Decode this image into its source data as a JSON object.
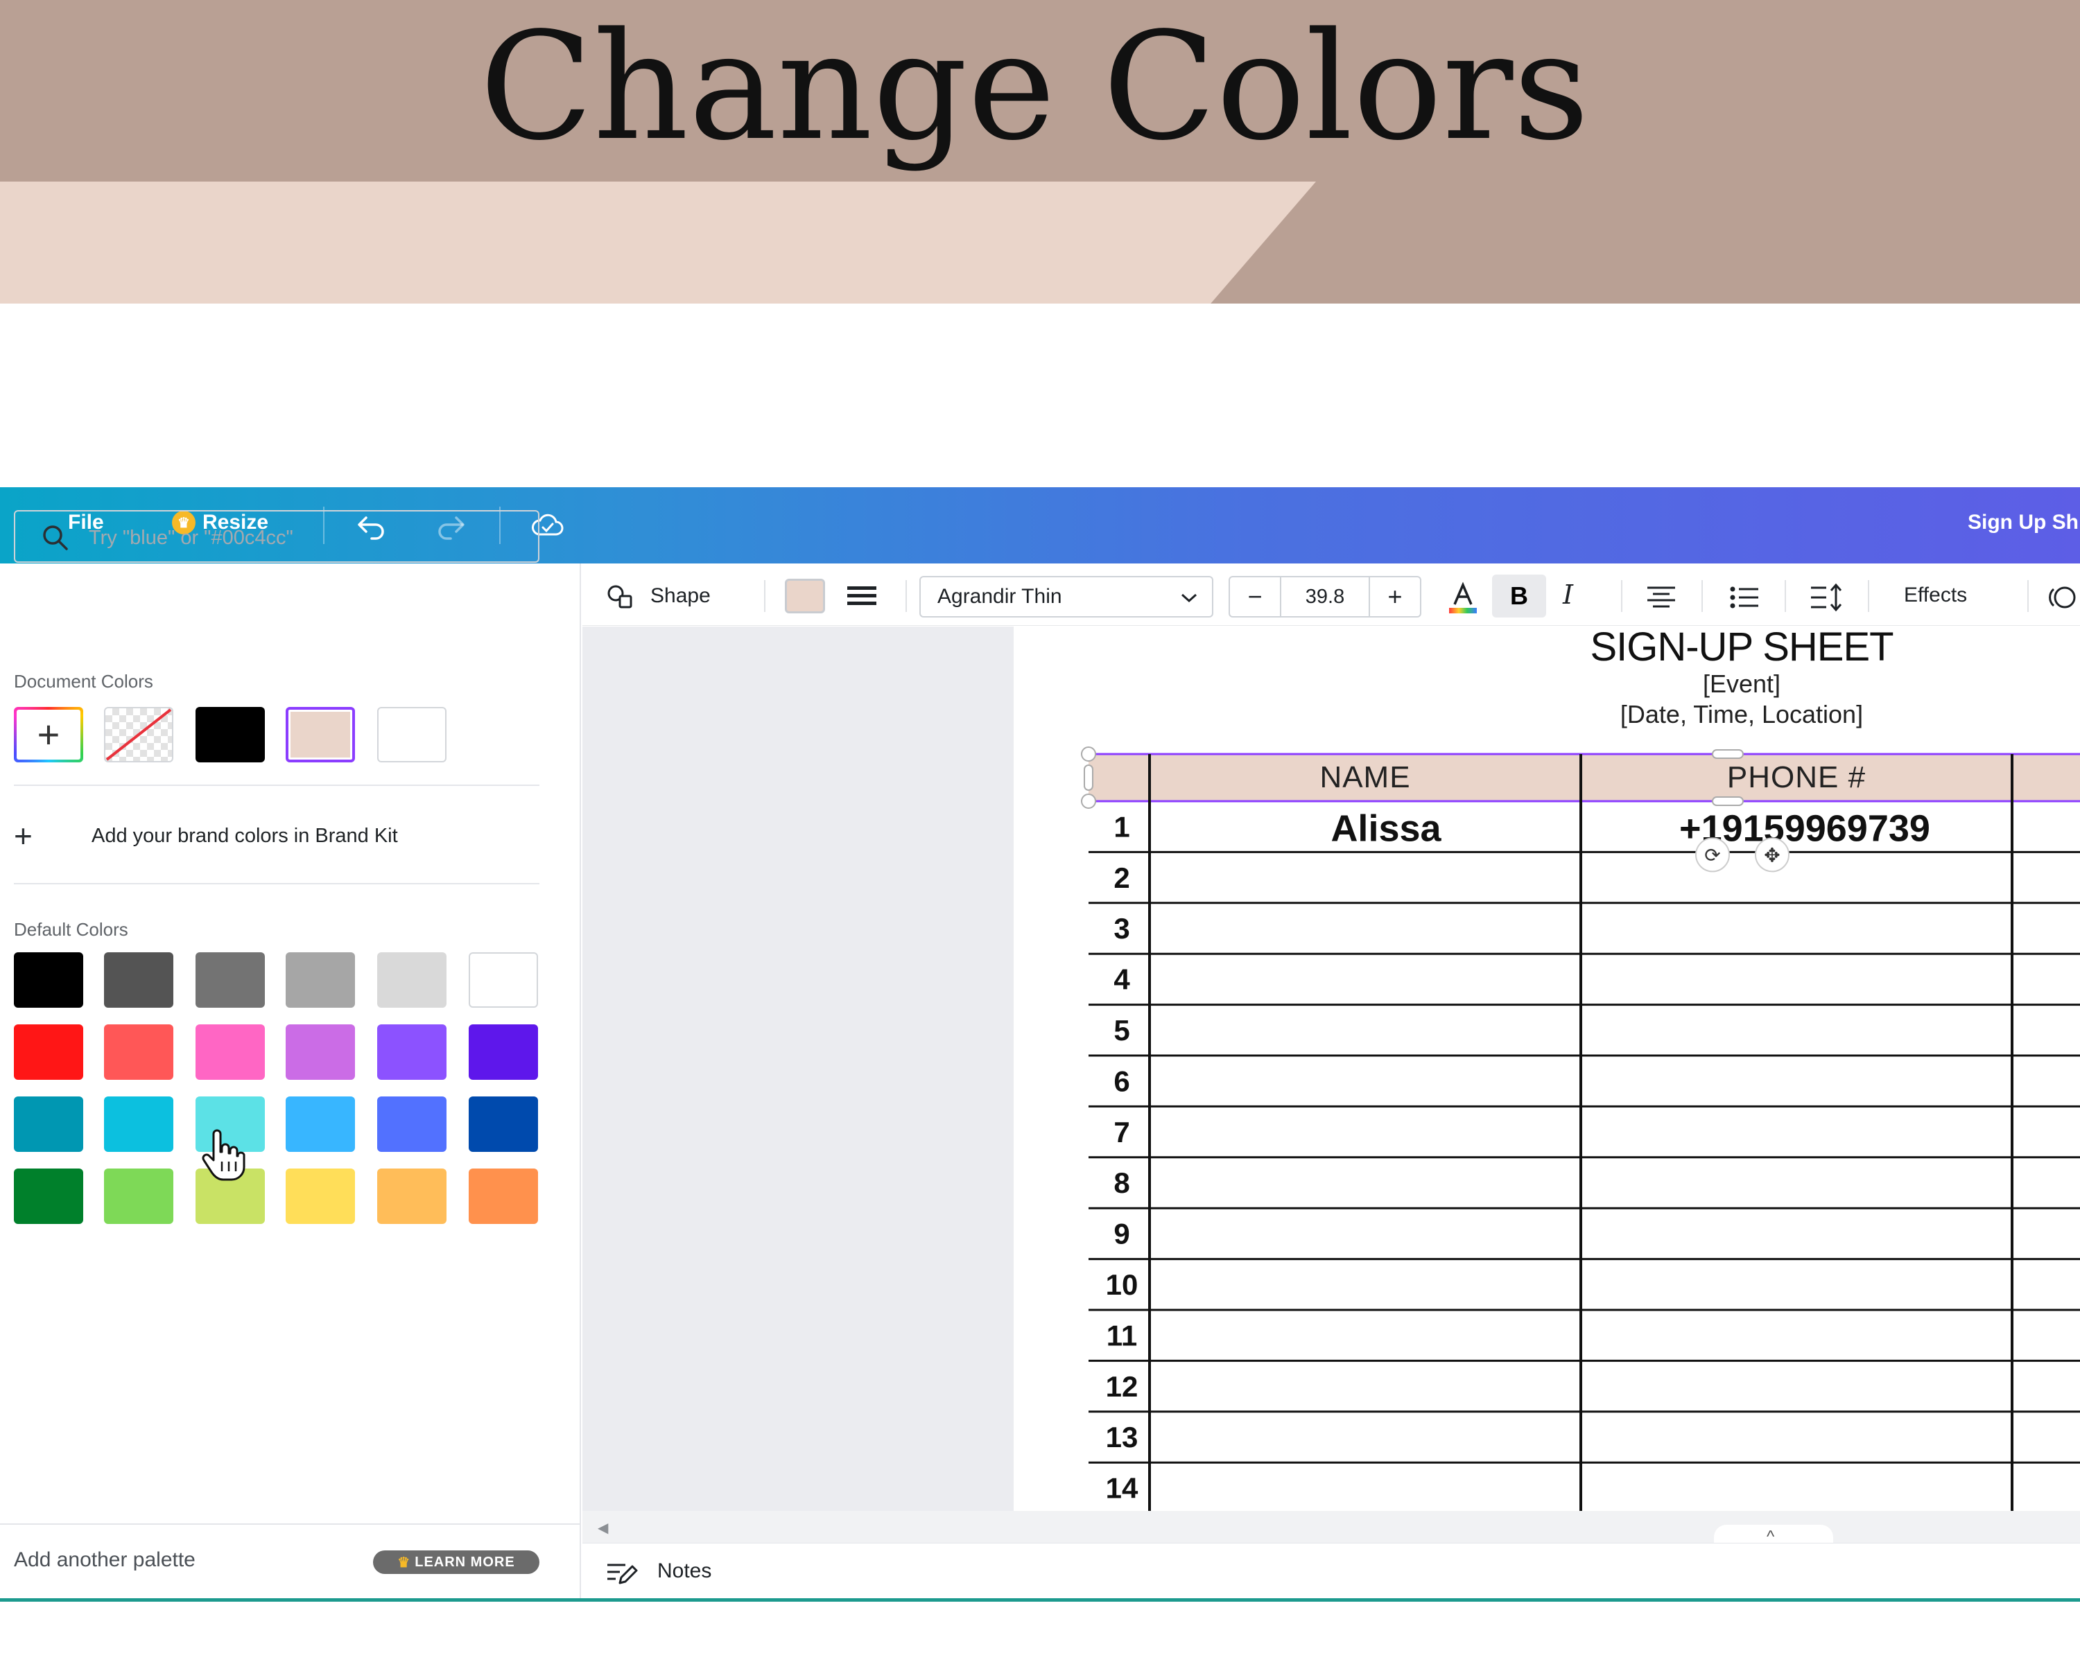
{
  "banner": {
    "title": "Change Colors"
  },
  "topbar": {
    "file_label": "File",
    "resize_label": "Resize",
    "project_title": "Sign Up Sh"
  },
  "color_panel": {
    "search_placeholder": "Try \"blue\" or \"#00c4cc\"",
    "document_colors_label": "Document Colors",
    "document_colors": [
      "#000000",
      "#ead5ca",
      "#ffffff"
    ],
    "selected_document_color": "#ead5ca",
    "add_brand_label": "Add your brand colors in Brand Kit",
    "default_colors_label": "Default Colors",
    "default_colors": [
      [
        "#000000",
        "#545454",
        "#737373",
        "#a6a6a6",
        "#d9d9d9",
        "#ffffff"
      ],
      [
        "#ff1616",
        "#ff5757",
        "#ff66c4",
        "#cb6ce6",
        "#8c52ff",
        "#5e17eb"
      ],
      [
        "#0097b2",
        "#0cc0df",
        "#5ce1e6",
        "#38b6ff",
        "#5271ff",
        "#004aad"
      ],
      [
        "#00802b",
        "#7ed957",
        "#c9e265",
        "#ffde59",
        "#ffbd59",
        "#ff914d"
      ]
    ],
    "add_palette_label": "Add another palette",
    "learn_more_label": "LEARN MORE"
  },
  "toolbar": {
    "shape_label": "Shape",
    "font_name": "Agrandir Thin",
    "font_size": "39.8",
    "bold_label": "B",
    "italic_label": "I",
    "effects_label": "Effects"
  },
  "sheet": {
    "title": "SIGN-UP SHEET",
    "event": "[Event]",
    "date_line": "[Date, Time, Location]",
    "columns": [
      "Name",
      "Phone #"
    ],
    "header_color": "#ead5ca",
    "rows": [
      {
        "num": "1",
        "name": "Alissa",
        "phone": "+19159969739"
      },
      {
        "num": "2",
        "name": "",
        "phone": ""
      },
      {
        "num": "3",
        "name": "",
        "phone": ""
      },
      {
        "num": "4",
        "name": "",
        "phone": ""
      },
      {
        "num": "5",
        "name": "",
        "phone": ""
      },
      {
        "num": "6",
        "name": "",
        "phone": ""
      },
      {
        "num": "7",
        "name": "",
        "phone": ""
      },
      {
        "num": "8",
        "name": "",
        "phone": ""
      },
      {
        "num": "9",
        "name": "",
        "phone": ""
      },
      {
        "num": "10",
        "name": "",
        "phone": ""
      },
      {
        "num": "11",
        "name": "",
        "phone": ""
      },
      {
        "num": "12",
        "name": "",
        "phone": ""
      },
      {
        "num": "13",
        "name": "",
        "phone": ""
      },
      {
        "num": "14",
        "name": "",
        "phone": ""
      }
    ]
  },
  "footer": {
    "notes_label": "Notes"
  },
  "colors": {
    "banner": "#b9a094",
    "banner_stripe": "#ead5ca",
    "accent_teal": "#1c9a8e",
    "selection_purple": "#8b3dff"
  }
}
